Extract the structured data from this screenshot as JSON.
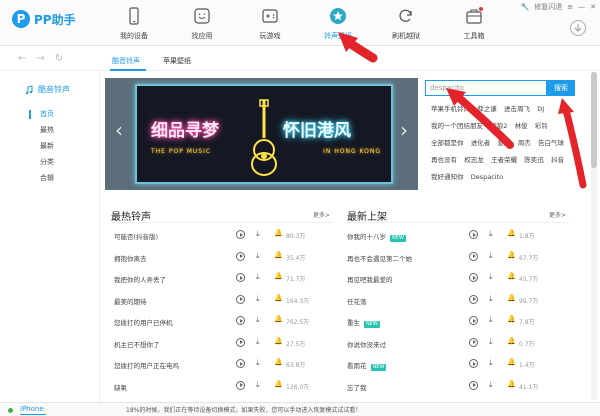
{
  "app": {
    "logo_text": "PP助手",
    "logo_mark": "P",
    "brand_color": "#1e9be9"
  },
  "window": {
    "repair_flash": "修复闪退"
  },
  "nav": [
    {
      "label": "我的设备",
      "icon": "phone-icon"
    },
    {
      "label": "找应用",
      "icon": "app-store-icon"
    },
    {
      "label": "玩游戏",
      "icon": "gamepad-icon"
    },
    {
      "label": "铃声壁纸",
      "icon": "ringtone-star-icon",
      "active": true
    },
    {
      "label": "刷机越狱",
      "icon": "refresh-icon"
    },
    {
      "label": "工具箱",
      "icon": "toolbox-icon"
    }
  ],
  "subtabs": [
    {
      "label": "酷音铃声",
      "active": true
    },
    {
      "label": "苹果壁纸"
    }
  ],
  "sidebar": {
    "title": "酷音铃声",
    "items": [
      {
        "label": "首页",
        "active": true
      },
      {
        "label": "最热"
      },
      {
        "label": "最新"
      },
      {
        "label": "分类"
      },
      {
        "label": "合辑"
      }
    ]
  },
  "banner": {
    "left_text": "细品寻梦",
    "right_text": "怀旧港风",
    "sub_words": [
      "THE POP MUSIC",
      "IN HONG KONG"
    ]
  },
  "search": {
    "value": "despacito",
    "placeholder": "despacito",
    "button": "搜索"
  },
  "keywords": [
    "苹果手机铃声",
    "薛之谦",
    "进击周飞",
    "DJ",
    "我的一个团结朋友",
    "战狼2",
    "林俊",
    "彩铃",
    "全部都是你",
    "进化者",
    "爱沉",
    "周杰",
    "告白气球",
    "再也没有",
    "权志龙",
    "王者荣耀",
    "陈奕迅",
    "抖音",
    "我好通知你",
    "Despacito"
  ],
  "hot": {
    "title": "最热铃声",
    "more": "更多>",
    "rows": [
      {
        "name": "可能否(抖音版)",
        "count": "80.3万"
      },
      {
        "name": "拥抱你离去",
        "count": "35.4万"
      },
      {
        "name": "我把你的人弄丢了",
        "count": "71.7万"
      },
      {
        "name": "最美的期待",
        "count": "164.3万"
      },
      {
        "name": "您拨打的用户已停机",
        "count": "762.5万"
      },
      {
        "name": "机主已不想你了",
        "count": "27.5万"
      },
      {
        "name": "您拨打的用户正在电鸡",
        "count": "63.8万"
      },
      {
        "name": "缺氧",
        "count": "126.0万"
      }
    ]
  },
  "newest": {
    "title": "最新上架",
    "more": "更多>",
    "rows": [
      {
        "name": "你我的十八岁",
        "new": "NEW",
        "count": "1.8万"
      },
      {
        "name": "再也不会遇见第二个她",
        "new": "",
        "count": "67.7万"
      },
      {
        "name": "再见吧我最爱的",
        "new": "",
        "count": "45.7万"
      },
      {
        "name": "任花落",
        "new": "",
        "count": "99.7万"
      },
      {
        "name": "重生",
        "new": "NEW",
        "count": "7.8万"
      },
      {
        "name": "你说你没来过",
        "new": "",
        "count": "0.7万"
      },
      {
        "name": "看雨花",
        "new": "NEW",
        "count": "1.4万"
      },
      {
        "name": "忘了我",
        "new": "",
        "count": "41.1万"
      }
    ]
  },
  "status": {
    "device": "iPhone",
    "message": "18%的时候，我们正在等待设备切换模式，如果失败，您可以手动进入恢复模式试试看！"
  }
}
